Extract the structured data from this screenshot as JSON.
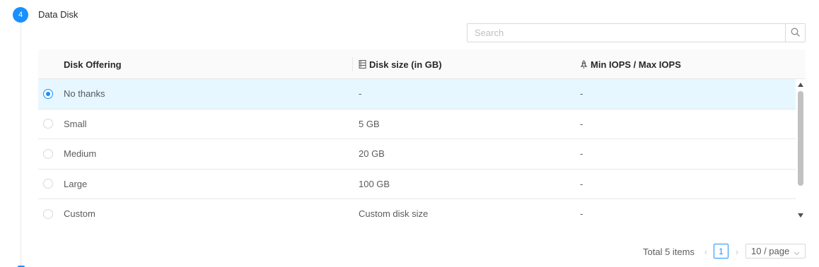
{
  "step": {
    "number": "4",
    "title": "Data Disk"
  },
  "search": {
    "placeholder": "Search"
  },
  "table": {
    "columns": {
      "offering": "Disk Offering",
      "size": "Disk size (in GB)",
      "iops": "Min IOPS / Max IOPS"
    },
    "rows": [
      {
        "name": "No thanks",
        "size": "-",
        "iops": "-",
        "selected": true
      },
      {
        "name": "Small",
        "size": "5 GB",
        "iops": "-",
        "selected": false
      },
      {
        "name": "Medium",
        "size": "20 GB",
        "iops": "-",
        "selected": false
      },
      {
        "name": "Large",
        "size": "100 GB",
        "iops": "-",
        "selected": false
      },
      {
        "name": "Custom",
        "size": "Custom disk size",
        "iops": "-",
        "selected": false
      }
    ]
  },
  "pagination": {
    "total": "Total 5 items",
    "current_page": "1",
    "page_size": "10 / page",
    "prev_icon": "‹",
    "next_icon": "›"
  },
  "colors": {
    "accent": "#1890ff",
    "selected_row": "#e6f7ff"
  }
}
